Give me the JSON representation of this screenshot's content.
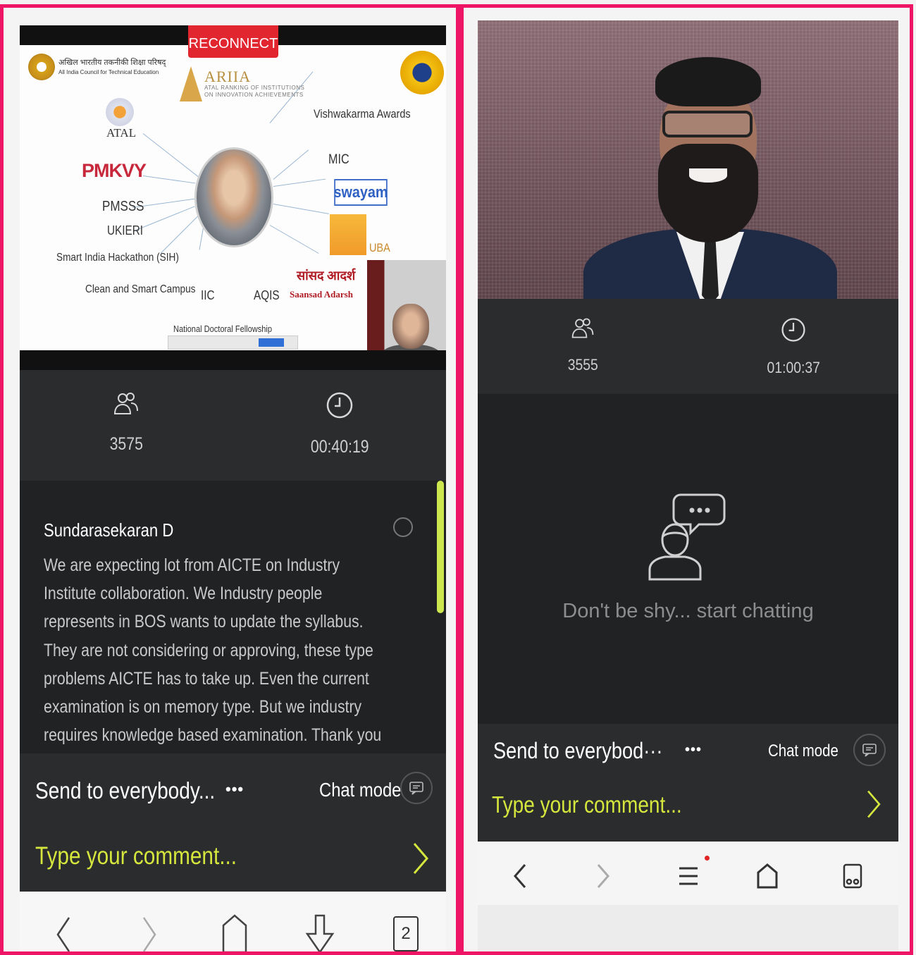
{
  "colors": {
    "frame_border": "#ee1466",
    "accent_comment": "#d5e63d",
    "reconnect_bg": "#e1262f",
    "dark_panel": "#2b2c2e",
    "chat_bg": "#212224"
  },
  "left": {
    "reconnect_label": "RECONNECT",
    "slide": {
      "aicte_hindi": "अखिल भारतीय तकनीकी शिक्षा परिषद्",
      "aicte_english": "All India Council for Technical Education",
      "ariia_title": "ARIIA",
      "ariia_sub": "ATAL RANKING OF INSTITUTIONS ON INNOVATION ACHIEVEMENTS",
      "atal": "ATAL",
      "pmkvy": "PMKVY",
      "vishwakarma": "Vishwakarma Awards",
      "mic": "MIC",
      "swayam": "swayam",
      "pmsss": "PMSSS",
      "ukieri": "UKIERI",
      "uba": "UBA",
      "sih": "Smart India Hackathon (SIH)",
      "clean_campus": "Clean and Smart Campus",
      "iic": "IIC",
      "aqis": "AQIS",
      "sansad_hindi": "सांसद आदर्श",
      "sansad_english": "Saansad Adarsh",
      "national_doctoral": "National Doctoral Fellowship"
    },
    "stats": {
      "participants_icon": "participants-icon",
      "participants": "3575",
      "timer_icon": "clock-icon",
      "elapsed": "00:40:19"
    },
    "chat": {
      "author": "Sundarasekaran D",
      "message": "We are expecting lot from AICTE on Industry Institute collaboration. We Industry people represents in BOS wants to update the syllabus. They are not considering or approving, these type problems AICTE has to take up. Even the current examination is on memory type. But we industry requires knowledge based examination. Thank you sir."
    },
    "composer": {
      "send_to": "Send to everybody...",
      "more": "•••",
      "chat_mode": "Chat mode",
      "placeholder": "Type your comment..."
    },
    "nav": {
      "tabs_count": "2"
    }
  },
  "right": {
    "stats": {
      "participants_icon": "participants-icon",
      "participants": "3555",
      "timer_icon": "clock-icon",
      "elapsed": "01:00:37"
    },
    "chat": {
      "empty_icon": "chat-person-icon",
      "empty_text": "Don't be shy... start chatting"
    },
    "composer": {
      "send_to": "Send to everybod···",
      "more": "•••",
      "chat_mode": "Chat mode",
      "placeholder": "Type your comment..."
    }
  }
}
